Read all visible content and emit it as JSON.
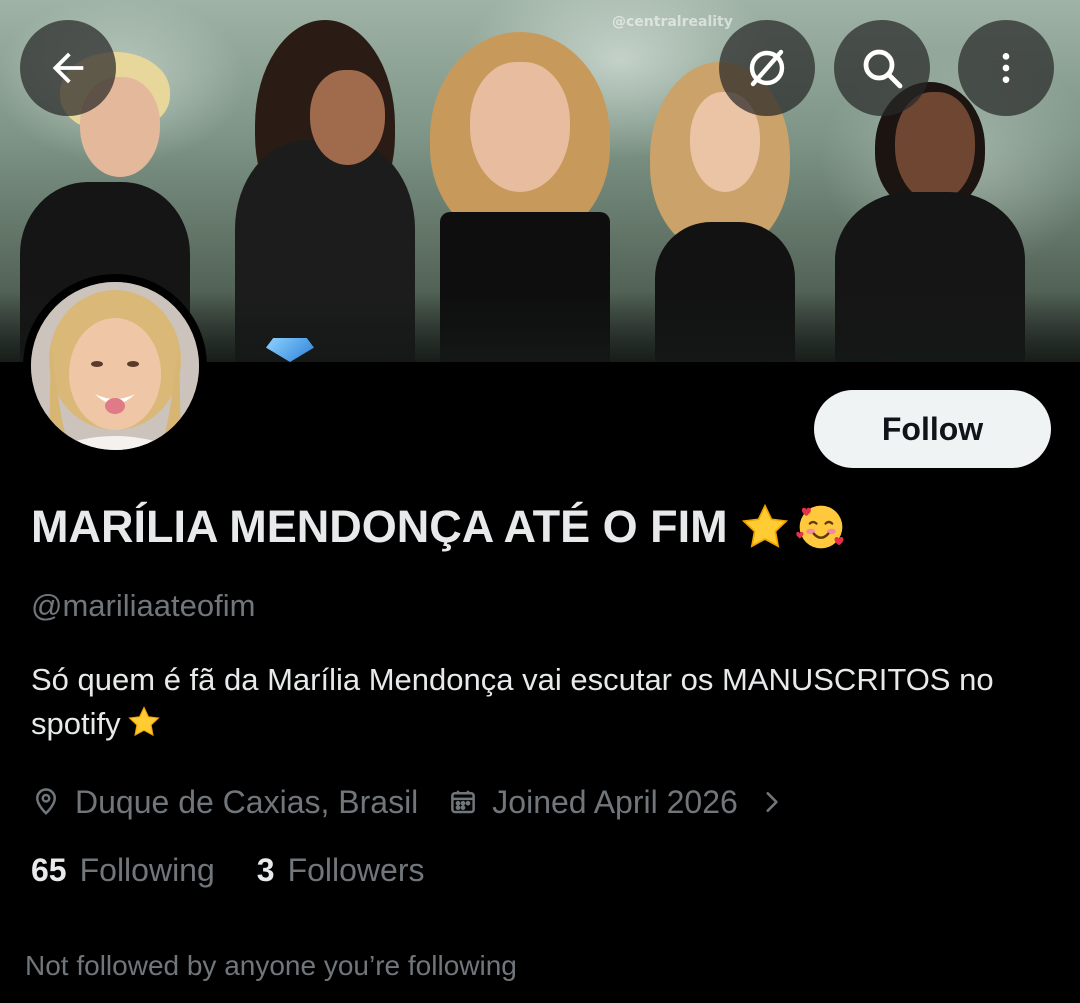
{
  "profile": {
    "banner_watermark": "@centralreality",
    "display_name": "MARÍLIA MENDONÇA ATÉ O FIM",
    "display_name_emojis": [
      "star-emoji",
      "smiling-face-with-hearts-emoji"
    ],
    "handle": "@mariliaateofim",
    "bio": "Só quem é fã da Marília Mendonça vai escutar os MANUSCRITOS no spotify",
    "bio_emoji": "star-emoji",
    "location": "Duque de Caxias, Brasil",
    "joined": "Joined April 2026",
    "following_count": "65",
    "following_label": "Following",
    "followers_count": "3",
    "followers_label": "Followers",
    "not_followed_note": "Not followed by anyone you’re following"
  },
  "header": {
    "back_icon": "arrow-left-icon",
    "translate_icon": "grok-slash-icon",
    "search_icon": "search-icon",
    "more_icon": "more-vertical-icon"
  },
  "actions": {
    "follow_label": "Follow"
  },
  "colors": {
    "background": "#000000",
    "primary_text": "#e7e9ea",
    "secondary_text": "#71767b",
    "follow_button_bg": "#eff3f4",
    "follow_button_text": "#0f1419"
  }
}
